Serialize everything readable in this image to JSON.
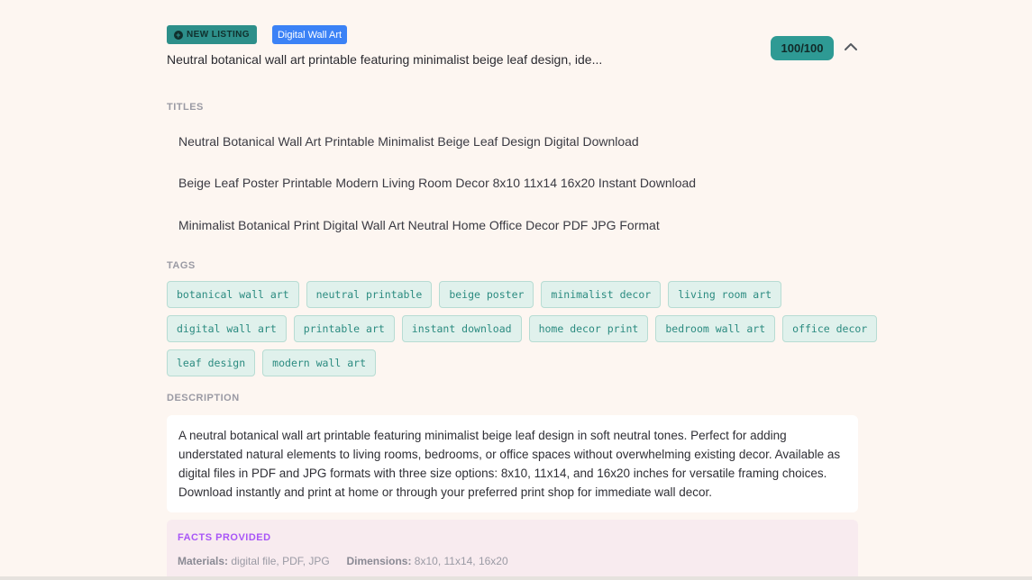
{
  "listing": {
    "badge_new": "NEW LISTING",
    "category": "Digital Wall Art",
    "summary": "Neutral botanical wall art printable featuring minimalist beige leaf design, ide...",
    "score": "100/100"
  },
  "titles": {
    "label": "TITLES",
    "items": [
      "Neutral Botanical Wall Art Printable Minimalist Beige Leaf Design Digital Download",
      "Beige Leaf Poster Printable Modern Living Room Decor 8x10 11x14 16x20 Instant Download",
      "Minimalist Botanical Print Digital Wall Art Neutral Home Office Decor PDF JPG Format"
    ]
  },
  "tags": {
    "label": "TAGS",
    "rows": [
      [
        "botanical wall art",
        "neutral printable",
        "beige poster",
        "minimalist decor",
        "living room art"
      ],
      [
        "digital wall art",
        "printable art",
        "instant download",
        "home decor print",
        "bedroom wall art",
        "office decor"
      ],
      [
        "leaf design",
        "modern wall art"
      ]
    ]
  },
  "description": {
    "label": "DESCRIPTION",
    "text": "A neutral botanical wall art printable featuring minimalist beige leaf design in soft neutral tones. Perfect for adding understated natural elements to living rooms, bedrooms, or office spaces without overwhelming existing decor. Available as digital files in PDF and JPG formats with three size options: 8x10, 11x14, and 16x20 inches for versatile framing choices. Download instantly and print at home or through your preferred print shop for immediate wall decor."
  },
  "facts": {
    "label": "FACTS PROVIDED",
    "materials_key": "Materials:",
    "materials_value": "digital file, PDF, JPG",
    "dimensions_key": "Dimensions:",
    "dimensions_value": "8x10, 11x14, 16x20"
  },
  "colors": {
    "background": "#fdf6f1",
    "accent_teal": "#2e9a94",
    "category_blue": "#3b82f6",
    "facts_purple": "#a855f7"
  },
  "icons": {
    "new_badge": "plus-circle-icon",
    "collapse": "chevron-up-icon"
  }
}
